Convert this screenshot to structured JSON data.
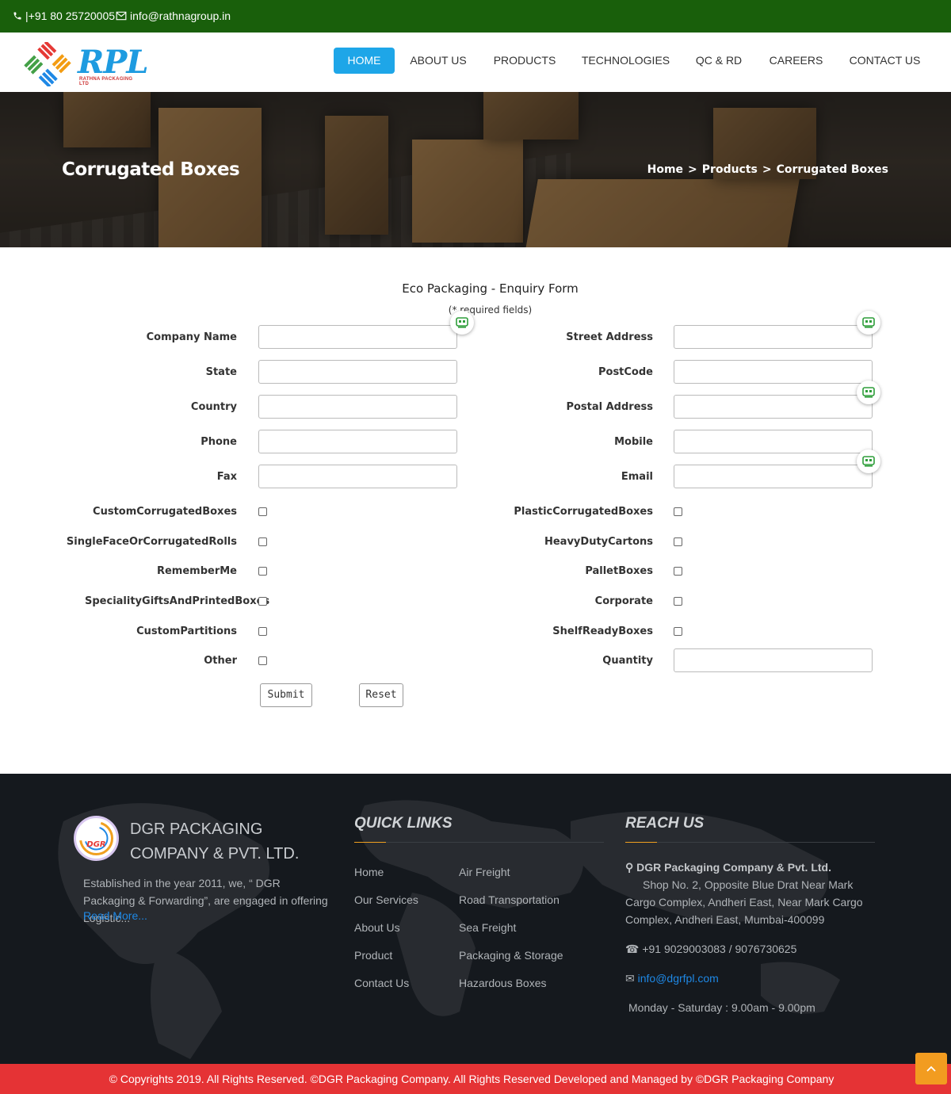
{
  "topbar": {
    "phone": "|+91 80 25720005",
    "email": "info@rathnagroup.in",
    "phone_icon": "phone-icon",
    "email_icon": "envelope-icon"
  },
  "logo": {
    "text": "RPL",
    "subtitle": "RATHNA PACKAGING LTD"
  },
  "nav": {
    "items": [
      "HOME",
      "ABOUT US",
      "PRODUCTS",
      "TECHNOLOGIES",
      "QC & RD",
      "CAREERS",
      "CONTACT US"
    ],
    "active": "HOME",
    "active_color": "#1ea6e8"
  },
  "banner": {
    "title": "Corrugated Boxes",
    "breadcrumb": [
      "Home",
      "Products",
      "Corrugated Boxes"
    ],
    "separator": ">"
  },
  "form": {
    "title": "Eco Packaging - Enquiry Form",
    "note": "(* required fields)",
    "left_fields": [
      "Company Name",
      "State",
      "Country",
      "Phone",
      "Fax"
    ],
    "right_fields": [
      "Street Address",
      "PostCode",
      "Postal Address",
      "Mobile",
      "Email"
    ],
    "left_checkboxes": [
      "CustomCorrugatedBoxes",
      "SingleFaceOrCorrugatedRolls",
      "RememberMe",
      "SpecialityGiftsAndPrintedBoxes",
      "CustomPartitions",
      "Other"
    ],
    "right_checkboxes": [
      "PlasticCorrugatedBoxes",
      "HeavyDutyCartons",
      "PalletBoxes",
      "Corporate",
      "ShelfReadyBoxes"
    ],
    "quantity_label": "Quantity",
    "submit": "Submit",
    "reset": "Reset",
    "autofill_icon": "password-manager-icon"
  },
  "footer": {
    "company": "DGR PACKAGING COMPANY & PVT. LTD.",
    "description": "Established in the year 2011, we, “ DGR Packaging & Forwarding”, are engaged in offering Logistic...",
    "read_more": "Read More...",
    "quick_links_title": "QUICK LINKS",
    "quick_links_col1": [
      "Home",
      "Our Services",
      "About Us",
      "Product",
      "Contact Us"
    ],
    "quick_links_col2": [
      "Air Freight",
      "Road Transportation",
      "Sea Freight",
      "Packaging & Storage",
      "Hazardous Boxes"
    ],
    "reach_title": "REACH US",
    "reach_company": "DGR Packaging Company & Pvt. Ltd.",
    "reach_address": "Shop No. 2, Opposite Blue Drat Near Mark Cargo Complex, Andheri East, Near Mark Cargo Complex, Andheri East, Mumbai-400099",
    "reach_phone": "+91 9029003083 / 9076730625",
    "reach_email": "info@dgrfpl.com",
    "reach_hours": "Monday - Saturday : 9.00am - 9.00pm",
    "copyright": "© Copyrights 2019. All Rights Reserved. ©DGR Packaging Company. All Rights Reserved Developed and Managed by ©DGR Packaging Company",
    "accent_color": "#f0a020",
    "copyright_bg": "#e53335"
  }
}
